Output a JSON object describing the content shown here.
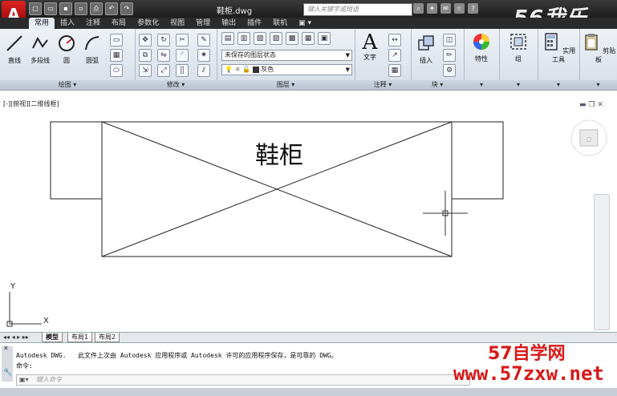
{
  "titlebar": {
    "app_logo": "A",
    "document_title": "鞋柜.dwg",
    "search_placeholder": "键入关键字或短语",
    "watermark": "56我乐"
  },
  "tabs": [
    "常用",
    "插入",
    "注释",
    "布局",
    "参数化",
    "视图",
    "管理",
    "输出",
    "插件",
    "联机"
  ],
  "ribbon": {
    "draw": {
      "title": "绘图 ▾",
      "line": "直线",
      "polyline": "多段线",
      "circle": "圆",
      "arc": "圆弧"
    },
    "modify": {
      "title": "修改 ▾"
    },
    "layers": {
      "title": "图层 ▾",
      "layer_state": "未保存的图层状态",
      "layer_color": "灰色"
    },
    "annotation": {
      "title": "注释 ▾",
      "text": "文字"
    },
    "block": {
      "title": "块 ▾",
      "insert": "插入"
    },
    "properties": {
      "label": "特性"
    },
    "groups": {
      "label": "组"
    },
    "utilities": {
      "label": "实用工具"
    },
    "clipboard": {
      "label": "剪贴板"
    }
  },
  "viewport": {
    "label": "[-][俯视][二维线框]",
    "drawing_text": "鞋柜"
  },
  "ucs": {
    "y_label": "Y",
    "x_label": "X"
  },
  "layout_tabs": [
    "模型",
    "布局1",
    "布局2"
  ],
  "command": {
    "line1": "Autodesk DWG.   此文件上次由 Autodesk 应用程序或 Autodesk 许可的应用程序保存，是可靠的 DWG。",
    "line2": "命令:",
    "placeholder": "键入命令"
  },
  "watermarks": {
    "site_name": "57自学网",
    "site_url": "www.57zxw.net"
  }
}
